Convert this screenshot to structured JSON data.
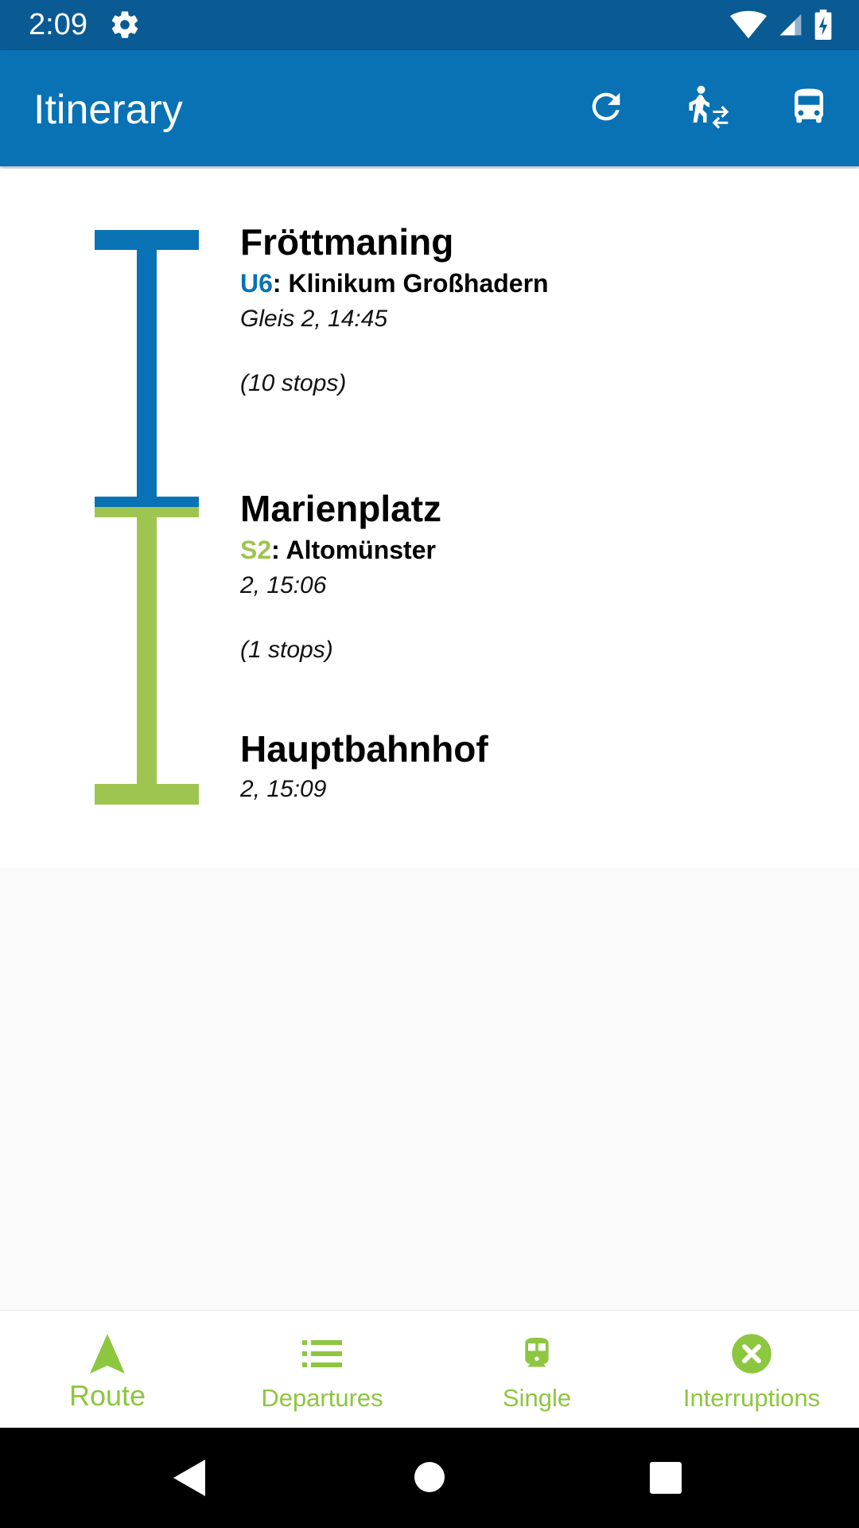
{
  "status_bar": {
    "time": "2:09",
    "icons": [
      "gear-icon",
      "wifi-icon",
      "signal-icon",
      "battery-charging-icon"
    ]
  },
  "app_bar": {
    "title": "Itinerary",
    "actions": [
      "refresh-icon",
      "walk-transfer-icon",
      "bus-icon"
    ]
  },
  "itinerary": {
    "stops": [
      {
        "name": "Fröttmaning",
        "line": "U6",
        "destination": ": Klinikum Großhadern",
        "platform_time": "Gleis 2, 14:45",
        "stops_count": "(10 stops)"
      },
      {
        "name": "Marienplatz",
        "line": "S2",
        "destination": ": Altomünster",
        "platform_time": "2, 15:06",
        "stops_count": "(1 stops)"
      },
      {
        "name": "Hauptbahnhof",
        "platform_time": "2, 15:09"
      }
    ],
    "colors": {
      "u6": "#0872b4",
      "s2": "#9ec54f"
    }
  },
  "bottom_nav": {
    "items": [
      {
        "label": "Route",
        "icon": "navigation-arrow-icon",
        "active": true
      },
      {
        "label": "Departures",
        "icon": "list-icon"
      },
      {
        "label": "Single",
        "icon": "train-icon"
      },
      {
        "label": "Interruptions",
        "icon": "cancel-circle-icon"
      }
    ],
    "accent": "#8dc63f"
  },
  "system_nav": [
    "back-icon",
    "home-icon",
    "recents-icon"
  ]
}
